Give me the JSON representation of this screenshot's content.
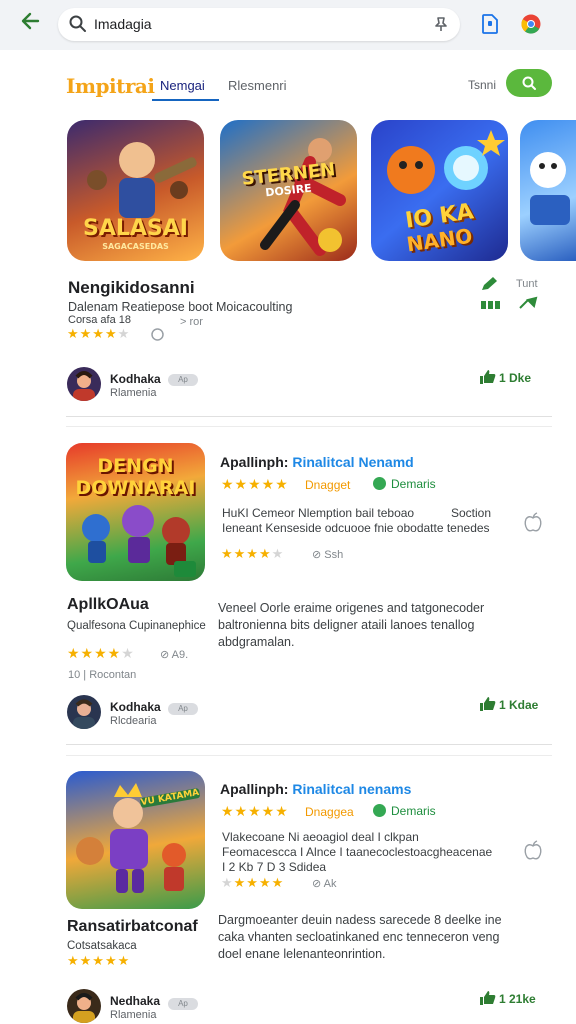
{
  "search": {
    "query": "Imadagia"
  },
  "tabs": {
    "brand": "Impitrai",
    "active": "Nemgai",
    "second": "Rlesmenri",
    "right_label": "Tsnni"
  },
  "featured": {
    "tiles": [
      {
        "title": "SALASAI",
        "subtitle": "SAGACASEDAS"
      },
      {
        "title": "STERNEN",
        "subtitle": "DOSIRE"
      },
      {
        "title": "IO KA",
        "subtitle": "NANO"
      },
      {
        "title": "",
        "subtitle": ""
      }
    ],
    "heading": "Nengikidosanni",
    "description": "Dalenam Reatiepose boot Moicacoulting",
    "meta": "Corsa afa 18",
    "meta_extra": "> ror",
    "right_top": "Tunt",
    "developer": {
      "name": "Kodhaka",
      "sub": "Rlamenia",
      "badge": "Ap",
      "likes": "1 Dke"
    }
  },
  "cards": [
    {
      "img_title": "DENGN DOWNARAI",
      "app_name": "Apallinph:",
      "app_sub": "Rinalitcal Nenamd",
      "tag1": "Dnagget",
      "tag2": "Demaris",
      "desc1": "HuKI Cemeor Nlemption bail teboao",
      "desc1_right": "Soction",
      "desc2": "Ieneant Kenseside odcuooe fnie obodatte tenedes",
      "rating_extra": "Ssh",
      "big_title": "ApllkOAua",
      "long_desc": "Veneel Oorle eraime origenes and tatgonecoder baltronienna bits deligner ataili lanoes tenallog abdgramalan.",
      "sub_label": "Qualfesona Cupinanephice",
      "rating_extra2": "A9.",
      "count_label": "10 | Rocontan",
      "developer": {
        "name": "Kodhaka",
        "sub": "Rlcdearia",
        "badge": "Ap",
        "likes": "1 Kdae"
      }
    },
    {
      "img_title": "VU KATAMA",
      "app_name": "Apallinph:",
      "app_sub": "Rinalitcal nenams",
      "tag1": "Dnaggea",
      "tag2": "Demaris",
      "desc1": "Vlakecoane Ni aeoagiol deal I clkpan",
      "desc2": "Feomacescca I Alnce I taanecoclestoacgheacenae",
      "desc3": "I 2 Kb 7 D 3 Sdidea",
      "rating_extra": "Ak",
      "big_title": "Ransatirbatconaf",
      "long_desc": "Dargmoeanter deuin nadess sarecede 8 deelke ine caka vhanten secloatinkaned enc tenneceron veng doel enane lelenanteonrintion.",
      "sub_label": "Cotsatsakaca",
      "developer": {
        "name": "Nedhaka",
        "sub": "Rlamenia",
        "badge": "Ap",
        "likes": "1 21ke"
      }
    }
  ],
  "colors": {
    "accent_green": "#5bb83d",
    "link_blue": "#1e88e5",
    "star": "#f6b000",
    "brand_orange": "#f4a418"
  }
}
